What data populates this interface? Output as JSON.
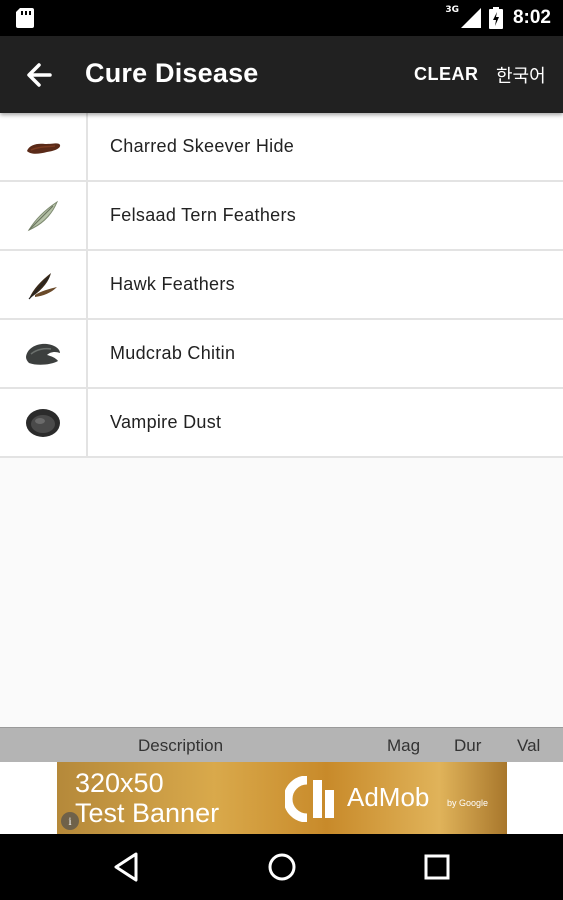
{
  "status_bar": {
    "network": "3G",
    "time": "8:02"
  },
  "app_bar": {
    "title": "Cure Disease",
    "clear_label": "CLEAR",
    "language_label": "한국어",
    "back_icon": "arrow-left-icon"
  },
  "ingredients": [
    {
      "name": "Charred Skeever Hide",
      "icon": "skeever-hide-icon"
    },
    {
      "name": "Felsaad Tern Feathers",
      "icon": "tern-feather-icon"
    },
    {
      "name": "Hawk Feathers",
      "icon": "hawk-feather-icon"
    },
    {
      "name": "Mudcrab Chitin",
      "icon": "mudcrab-chitin-icon"
    },
    {
      "name": "Vampire Dust",
      "icon": "vampire-dust-icon"
    }
  ],
  "table_header": {
    "description": "Description",
    "mag": "Mag",
    "dur": "Dur",
    "val": "Val"
  },
  "ad": {
    "size_text": "320x50",
    "banner_text": "Test Banner",
    "brand": "AdMob",
    "by_google": "by Google",
    "info_glyph": "i"
  },
  "colors": {
    "app_bar": "#212121",
    "status_bar": "#000000",
    "header_strip": "#b4b4b4",
    "divider": "#e3e3e3"
  }
}
